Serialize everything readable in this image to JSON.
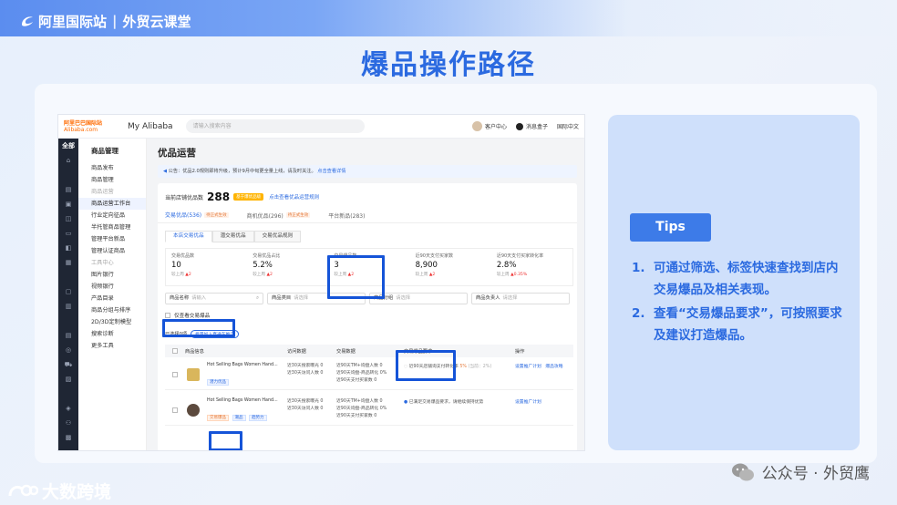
{
  "brand": {
    "name": "阿里国际站",
    "separator": "|",
    "sub": "外贸云课堂"
  },
  "title": "爆品操作路径",
  "screen": {
    "logo_line1": "阿里巴巴国际站",
    "logo_line2": "Alibaba.com",
    "my_alibaba": "My Alibaba",
    "search_placeholder": "请输入搜索内容",
    "account": "客户中心",
    "message_box": "消息盒子",
    "language": "国际中文",
    "rail": [
      "全部"
    ],
    "menu": {
      "head": "商品管理",
      "items": [
        {
          "label": "商品发布",
          "kind": "item"
        },
        {
          "label": "商品管理",
          "kind": "item"
        },
        {
          "label": "商品运营",
          "kind": "group"
        },
        {
          "label": "商品运营工作台",
          "kind": "active"
        },
        {
          "label": "行业定向征品",
          "kind": "item"
        },
        {
          "label": "半托管商品管理",
          "kind": "item"
        },
        {
          "label": "管理平台新品",
          "kind": "item"
        },
        {
          "label": "管理认证商品",
          "kind": "item"
        },
        {
          "label": "工具中心",
          "kind": "group"
        },
        {
          "label": "图片银行",
          "kind": "item"
        },
        {
          "label": "视频银行",
          "kind": "item"
        },
        {
          "label": "产品目录",
          "kind": "item"
        },
        {
          "label": "商品分组与排序",
          "kind": "item"
        },
        {
          "label": "2D/3D定制模型",
          "kind": "item"
        },
        {
          "label": "搜索诊断",
          "kind": "item"
        },
        {
          "label": "更多工具",
          "kind": "item"
        }
      ]
    },
    "page_title": "优品运营",
    "notice_text": "公告：优品2.0规则即将升级，预计9月中旬更全量上线，请及时关注。",
    "notice_link": "点击查看详情",
    "stat_label": "当前店铺优品数",
    "stat_value": "288",
    "stat_tag": "基于爆优品级",
    "stat_link": "点击查看优品运营规则",
    "tabs": [
      {
        "label": "交易优品(536)",
        "tag": "待正式生效",
        "active": true
      },
      {
        "label": "商机优品(296)",
        "tag": "待正式生效",
        "active": false
      },
      {
        "label": "平台新品(283)",
        "tag": "",
        "active": false
      }
    ],
    "subtabs": [
      "本店交易优品",
      "潜交易优品",
      "交易优品规则"
    ],
    "metrics": [
      {
        "label": "交易优品数",
        "value": "10",
        "delta_label": "较上周",
        "delta": "2"
      },
      {
        "label": "交易优品占比",
        "value": "5.2%",
        "delta_label": "较上周",
        "delta": "2"
      },
      {
        "label": "交易爆品数",
        "value": "3",
        "delta_label": "较上周",
        "delta": "2"
      },
      {
        "label": "近90天支付买家数",
        "value": "8,900",
        "delta_label": "较上周",
        "delta": "2"
      },
      {
        "label": "近90天支付买家转化率",
        "value": "2.8%",
        "delta_label": "较上周",
        "delta": "0.35%"
      }
    ],
    "filters": [
      {
        "label": "商品名称",
        "placeholder": "请输入"
      },
      {
        "label": "商品类目",
        "placeholder": "请选择"
      },
      {
        "label": "商品分组",
        "placeholder": "请选择"
      },
      {
        "label": "商品负责人",
        "placeholder": "请选择"
      }
    ],
    "only_hot_label": "仅查看交易爆品",
    "selected_label": "已选择0项",
    "batch_button": "批量加入直通车推广",
    "table_headers": [
      "商品信息",
      "访问数据",
      "交易数据",
      "交易爆品要求",
      "操作"
    ],
    "rows": [
      {
        "title": "Hot Selling Bags Women Hand...",
        "tag": "潜力优品",
        "visit": [
          "近30天搜索曝光",
          "近30天访问人数"
        ],
        "visit_vals": [
          "0",
          "0"
        ],
        "trade": [
          "近90天TM+询盘人数",
          "近90天询盘-商品转化",
          "近90天支付买家数"
        ],
        "trade_vals": [
          "0",
          "0%",
          "0"
        ],
        "requirement": "近90天店铺询支付转化率",
        "req_value": "5%",
        "req_note": "(当前：2%)",
        "ops": [
          "设置推广计划",
          "爆品攻略"
        ]
      },
      {
        "title": "Hot Selling Bags Women Hand...",
        "tags": [
          "交易爆品",
          "潮品",
          "趋势力"
        ],
        "visit": [
          "近30天搜索曝光",
          "近30天访问人数"
        ],
        "visit_vals": [
          "0",
          "0"
        ],
        "trade": [
          "近90天TM+询盘人数",
          "近90天询盘-商品转化",
          "近90天支付买家数"
        ],
        "trade_vals": [
          "0",
          "0%",
          "0"
        ],
        "requirement": "已满足交易爆品要求，请继续保持优势",
        "ops": [
          "设置推广计划"
        ]
      }
    ]
  },
  "tips": {
    "button": "Tips",
    "items": [
      {
        "num": "1.",
        "text": "可通过筛选、标签快速查找到店内交易爆品及相关表现。"
      },
      {
        "num": "2.",
        "text": "查看“交易爆品要求”，可按照要求及建议打造爆品。"
      }
    ]
  },
  "watermark": "公众号 · 外贸鹰",
  "corner_brand": "大数跨境",
  "colors": {
    "accent": "#2b6ae0",
    "highlight": "#1554d8",
    "orange": "#ff6a00"
  }
}
